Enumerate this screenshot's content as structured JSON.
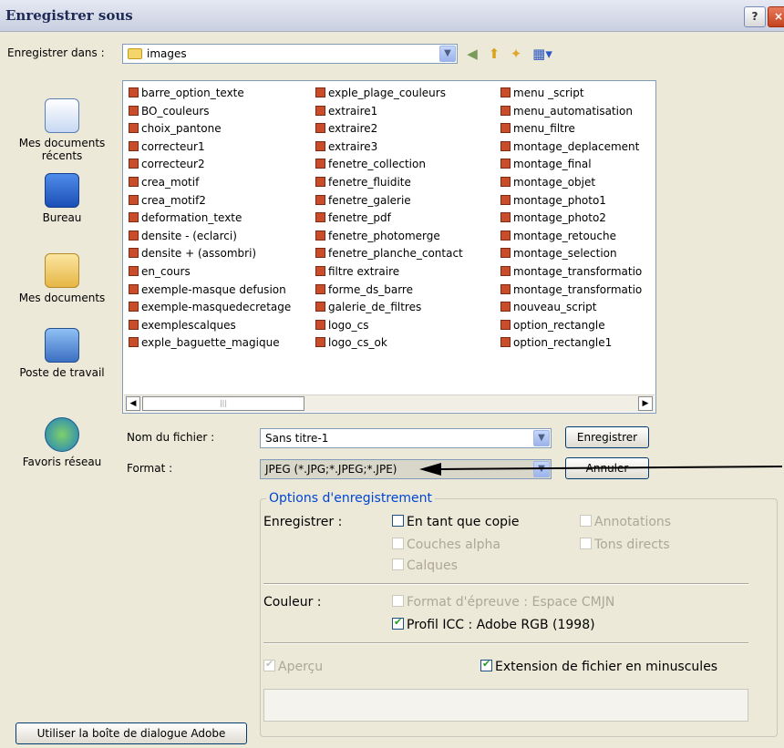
{
  "window": {
    "title": "Enregistrer sous",
    "help": "?",
    "close": "×"
  },
  "save_in": {
    "label": "Enregistrer dans :",
    "value": "images"
  },
  "places": [
    {
      "label": "Mes documents récents",
      "icon": "recent-documents-icon"
    },
    {
      "label": "Bureau",
      "icon": "desktop-icon"
    },
    {
      "label": "Mes documents",
      "icon": "my-documents-icon"
    },
    {
      "label": "Poste de travail",
      "icon": "my-computer-icon"
    },
    {
      "label": "Favoris réseau",
      "icon": "network-places-icon"
    }
  ],
  "files": {
    "col1": [
      "barre_option_texte",
      "BO_couleurs",
      "choix_pantone",
      "correcteur1",
      "correcteur2",
      "crea_motif",
      "crea_motif2",
      "deformation_texte",
      "densite - (eclarci)",
      "densite + (assombri)",
      "en_cours",
      "exemple-masque defusion",
      "exemple-masquedecretage",
      "exemplescalques",
      "exple_baguette_magique"
    ],
    "col2": [
      "exple_plage_couleurs",
      "extraire1",
      "extraire2",
      "extraire3",
      "fenetre_collection",
      "fenetre_fluidite",
      "fenetre_galerie",
      "fenetre_pdf",
      "fenetre_photomerge",
      "fenetre_planche_contact",
      "filtre extraire",
      "forme_ds_barre",
      "galerie_de_filtres",
      "logo_cs",
      "logo_cs_ok"
    ],
    "col3": [
      "menu _script",
      "menu_automatisation",
      "menu_filtre",
      "montage_deplacement",
      "montage_final",
      "montage_objet",
      "montage_photo1",
      "montage_photo2",
      "montage_retouche",
      "montage_selection",
      "montage_transformatio",
      "montage_transformatio",
      "nouveau_script",
      "option_rectangle",
      "option_rectangle1"
    ]
  },
  "filename": {
    "label": "Nom du fichier :",
    "value": "Sans titre-1"
  },
  "format": {
    "label": "Format :",
    "value": "JPEG (*.JPG;*.JPEG;*.JPE)"
  },
  "buttons": {
    "save": "Enregistrer",
    "cancel": "Annuler",
    "adobe": "Utiliser la boîte de dialogue Adobe"
  },
  "options": {
    "title": "Options d'enregistrement",
    "save_label": "Enregistrer :",
    "as_copy": "En tant que copie",
    "annotations": "Annotations",
    "alpha": "Couches alpha",
    "spot": "Tons directs",
    "layers": "Calques",
    "color_label": "Couleur :",
    "proof": "Format d'épreuve : Espace CMJN",
    "icc": "Profil ICC : Adobe RGB (1998)",
    "preview": "Aperçu",
    "lowercase_ext": "Extension de fichier en minuscules"
  }
}
